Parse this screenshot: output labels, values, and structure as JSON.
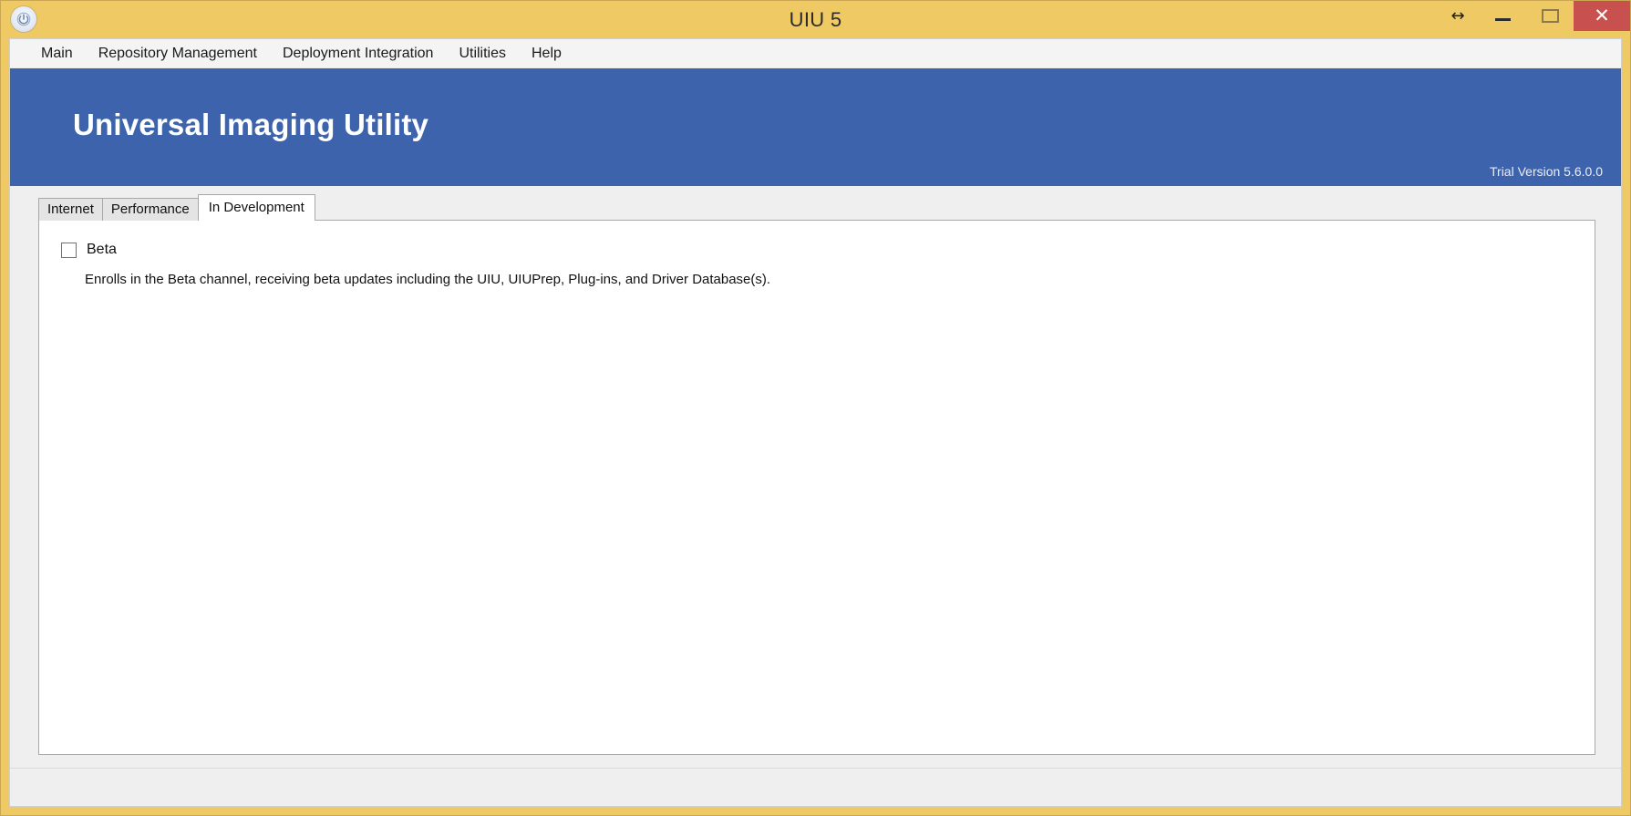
{
  "window": {
    "title": "UIU 5",
    "app_icon": "power-icon",
    "controls": {
      "resize_hint": "↔",
      "minimize_label": "—",
      "maximize_label": "□",
      "close_label": "✕"
    },
    "colors": {
      "chrome": "#efc963",
      "banner": "#3d63ac",
      "close_button": "#c8514f",
      "client_background": "#efefef",
      "panel_background": "#ffffff"
    }
  },
  "menu": {
    "items": [
      {
        "label": "Main"
      },
      {
        "label": "Repository Management"
      },
      {
        "label": "Deployment Integration"
      },
      {
        "label": "Utilities"
      },
      {
        "label": "Help"
      }
    ]
  },
  "banner": {
    "title": "Universal Imaging Utility",
    "version": "Trial Version 5.6.0.0"
  },
  "tabs": {
    "items": [
      {
        "label": "Internet",
        "active": false
      },
      {
        "label": "Performance",
        "active": false
      },
      {
        "label": "In Development",
        "active": true
      }
    ],
    "active_index": 2
  },
  "in_development_panel": {
    "beta": {
      "label": "Beta",
      "checked": false,
      "description": "Enrolls in the Beta channel, receiving beta updates including the UIU, UIUPrep, Plug-ins, and Driver Database(s)."
    }
  },
  "status_bar": {
    "text": ""
  }
}
